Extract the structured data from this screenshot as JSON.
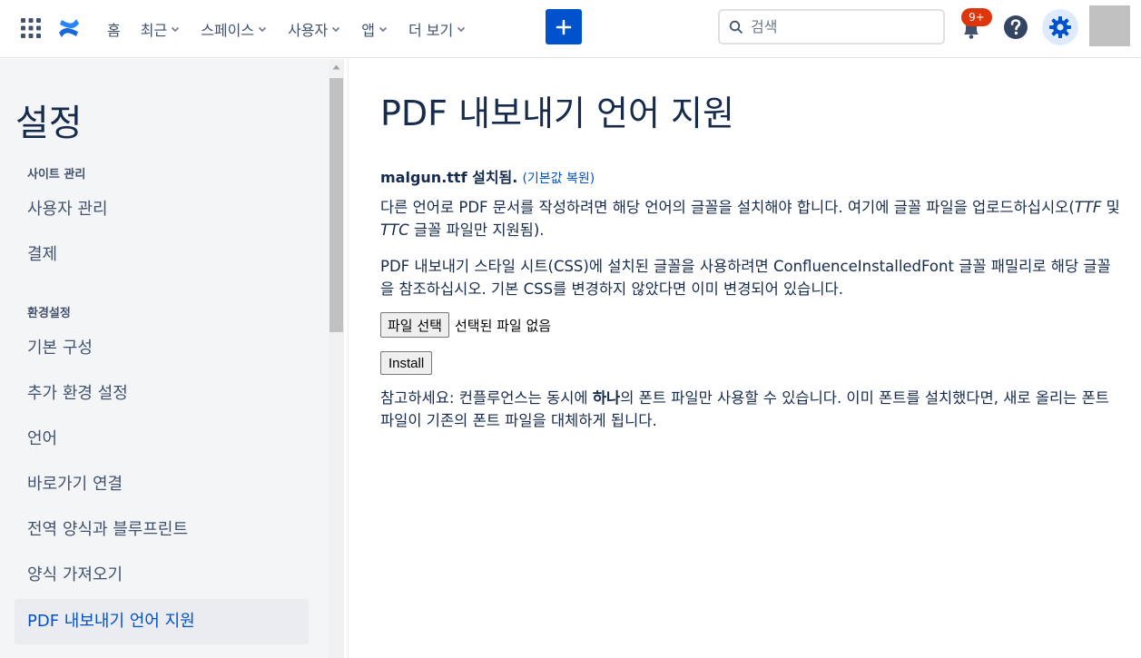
{
  "topnav": {
    "items": [
      {
        "label": "홈",
        "has_dropdown": false
      },
      {
        "label": "최근",
        "has_dropdown": true
      },
      {
        "label": "스페이스",
        "has_dropdown": true
      },
      {
        "label": "사용자",
        "has_dropdown": true
      },
      {
        "label": "앱",
        "has_dropdown": true
      },
      {
        "label": "더 보기",
        "has_dropdown": true
      }
    ],
    "create_icon": "plus-icon",
    "search_placeholder": "검색",
    "notification_badge": "9+",
    "icons": {
      "app_switcher": "app-grid-icon",
      "logo": "confluence-logo",
      "search": "search-icon",
      "notifications": "bell-icon",
      "help": "help-icon",
      "settings": "gear-icon"
    }
  },
  "sidebar": {
    "title": "설정",
    "sections": [
      {
        "heading": "사이트 관리",
        "items": [
          "사용자 관리",
          "결제"
        ]
      },
      {
        "heading": "환경설정",
        "items": [
          "기본 구성",
          "추가 환경 설정",
          "언어",
          "바로가기 연결",
          "전역 양식과 블루프린트",
          "양식 가져오기",
          "PDF 내보내기 언어 지원"
        ]
      }
    ],
    "active_item": "PDF 내보내기 언어 지원"
  },
  "main": {
    "title": "PDF 내보내기 언어 지원",
    "status_bold": "malgun.ttf 설치됨.",
    "restore_link": "(기본값 복원)",
    "para1_a": "다른 언어로 PDF 문서를 작성하려면 해당 언어의 글꼴을 설치해야 합니다. 여기에 글꼴 파일을 업로드하십시오(",
    "para1_ttf": "TTF",
    "para1_b": " 및 ",
    "para1_ttc": "TTC",
    "para1_c": " 글꼴 파일만 지원됨).",
    "para2": "PDF 내보내기 스타일 시트(CSS)에 설치된 글꼴을 사용하려면 ConfluenceInstalledFont 글꼴 패밀리로 해당 글꼴을 참조하십시오. 기본 CSS를 변경하지 않았다면 이미 변경되어 있습니다.",
    "file_button": "파일 선택",
    "file_none": "선택된 파일 없음",
    "install_button": "Install",
    "note_a": "참고하세요: 컨플루언스는 동시에 ",
    "note_bold": "하나",
    "note_b": "의 폰트 파일만 사용할 수 있습니다. 이미 폰트를 설치했다면, 새로 올리는 폰트 파일이 기존의 폰트 파일을 대체하게 됩니다."
  },
  "colors": {
    "brand": "#0052cc",
    "badge": "#de350b",
    "sidebar_bg": "#f4f5f7",
    "active_bg": "#ebecf0"
  }
}
